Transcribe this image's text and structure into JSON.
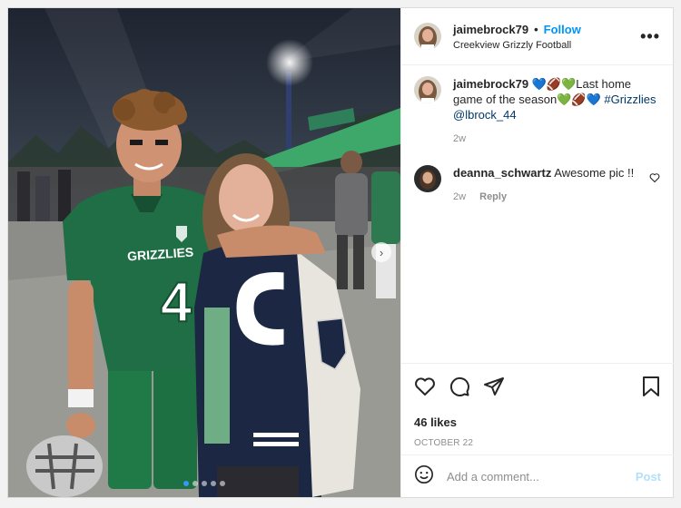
{
  "post": {
    "username": "jaimebrock79",
    "follow_label": "Follow",
    "separator": "•",
    "location": "Creekview Grizzly Football",
    "more_label": "•••"
  },
  "caption": {
    "username": "jaimebrock79",
    "text_part1": "Last home game of the season",
    "hashtag": "#Grizzlies",
    "mention": "@lbrock_44",
    "emoji1": "💙🏈💚",
    "emoji2": "💚🏈💙",
    "time": "2w"
  },
  "comments": [
    {
      "username": "deanna_schwartz",
      "text": "Awesome pic !!",
      "time": "2w",
      "reply_label": "Reply"
    }
  ],
  "likes": "46 likes",
  "date": "OCTOBER 22",
  "add_comment": {
    "placeholder": "Add a comment...",
    "post_label": "Post"
  },
  "carousel": {
    "count": 5,
    "active_index": 0
  },
  "jersey": {
    "team_text": "GRIZZLIES",
    "number": "4"
  },
  "colors": {
    "accent": "#0095f6",
    "jersey_green": "#1f6e45",
    "jacket_navy": "#1c2744"
  }
}
